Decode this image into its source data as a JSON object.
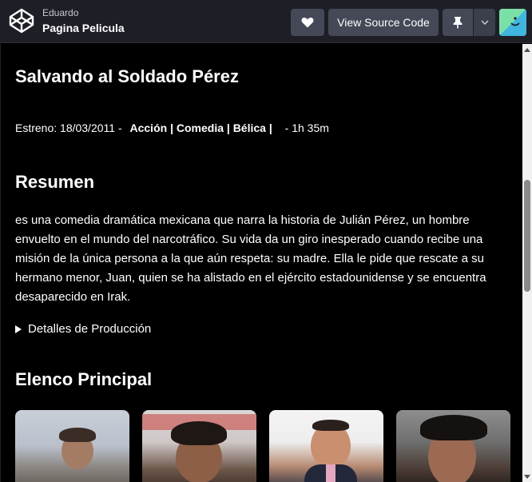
{
  "header": {
    "author": "Eduardo",
    "title": "Pagina Pelicula",
    "view_source_label": "View Source Code"
  },
  "movie": {
    "title": "Salvando al Soldado Pérez",
    "release_label": "Estreno: 18/03/2011 -",
    "genres": "Acción | Comedia | Bélica |",
    "duration": "- 1h 35m"
  },
  "summary": {
    "heading": "Resumen",
    "text": "es una comedia dramática mexicana que narra la historia de Julián Pérez, un hombre envuelto en el mundo del narcotráfico. Su vida da un giro inesperado cuando recibe una misión de la única persona a la que aún respeta: su madre. Ella le pide que rescate a su hermano menor, Juan, quien se ha alistado en el ejército estadounidense y se encuentra desaparecido en Irak.",
    "details_label": "Detalles de Producción"
  },
  "cast": {
    "heading": "Elenco Principal"
  },
  "colors": {
    "topbar": "#1e1f26",
    "button": "#444857",
    "background": "#000000"
  }
}
